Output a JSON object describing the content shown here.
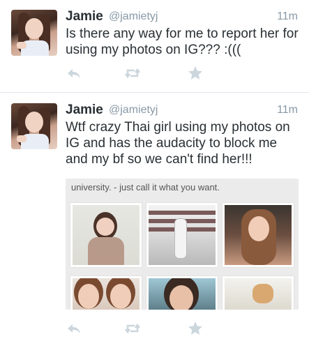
{
  "colors": {
    "text": "#292f33",
    "secondary": "#8899a6",
    "divider": "#e1e8ed",
    "action_icon": "#ccd6dd"
  },
  "tweets": [
    {
      "name": "Jamie",
      "handle": "@jamietyj",
      "time": "11m",
      "text": "Is there any way for me to report her for using my photos on IG??? :(((",
      "actions": {
        "reply_icon": "reply-icon",
        "retweet_icon": "retweet-icon",
        "favorite_icon": "star-icon"
      }
    },
    {
      "name": "Jamie",
      "handle": "@jamietyj",
      "time": "11m",
      "text": "Wtf crazy Thai girl using my photos on IG and has the audacity to block me and my bf so we can't find her!!!",
      "media": {
        "caption": "university. - just call it what you want.",
        "photo_count": 6
      },
      "actions": {
        "reply_icon": "reply-icon",
        "retweet_icon": "retweet-icon",
        "favorite_icon": "star-icon"
      }
    }
  ]
}
